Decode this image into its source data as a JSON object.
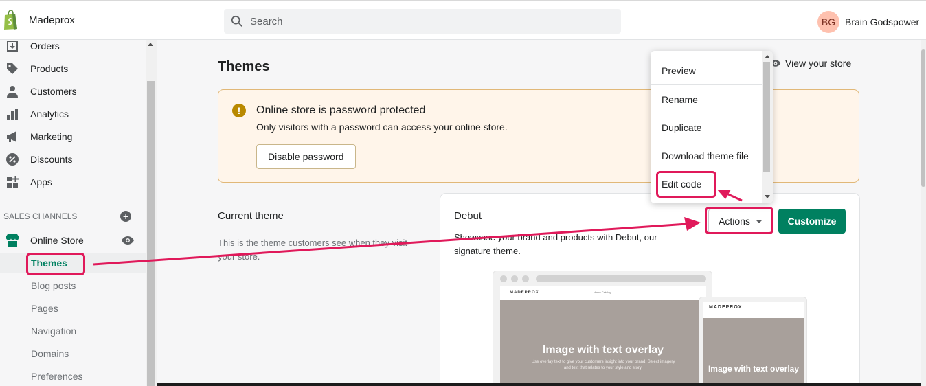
{
  "store": {
    "name": "Madeprox"
  },
  "search": {
    "placeholder": "Search"
  },
  "user": {
    "initials": "BG",
    "name": "Brain Godspower"
  },
  "sidebar": {
    "items": [
      {
        "label": "Orders",
        "icon": "orders-icon"
      },
      {
        "label": "Products",
        "icon": "tag-icon"
      },
      {
        "label": "Customers",
        "icon": "person-icon"
      },
      {
        "label": "Analytics",
        "icon": "bar-chart-icon"
      },
      {
        "label": "Marketing",
        "icon": "megaphone-icon"
      },
      {
        "label": "Discounts",
        "icon": "discount-icon"
      },
      {
        "label": "Apps",
        "icon": "apps-icon"
      }
    ],
    "sales_channels_label": "SALES CHANNELS",
    "online_store": "Online Store",
    "sub_items": [
      "Themes",
      "Blog posts",
      "Pages",
      "Navigation",
      "Domains",
      "Preferences"
    ],
    "active_sub_item": "Themes"
  },
  "main": {
    "page_title": "Themes",
    "view_store": "View your store",
    "banner": {
      "title": "Online store is password protected",
      "text": "Only visitors with a password can access your online store.",
      "button": "Disable password"
    },
    "current_theme": {
      "heading": "Current theme",
      "description": "This is the theme customers see when they visit your store."
    },
    "theme_card": {
      "name": "Debut",
      "description": "Showcase your brand and products with Debut, our signature theme.",
      "actions_button": "Actions",
      "customize_button": "Customize",
      "preview": {
        "store_name": "MADEPROX",
        "nav_links": "Home   Catalog",
        "desktop_hero_title": "Image with text overlay",
        "desktop_hero_sub": "Use overlay text to give your customers insight into your brand. Select imagery and text that relates to your style and story.",
        "mobile_hero_title": "Image with text overlay"
      }
    }
  },
  "actions_menu": {
    "items": [
      "Preview",
      "Rename",
      "Duplicate",
      "Download theme file",
      "Edit code"
    ],
    "highlighted": "Edit code"
  },
  "colors": {
    "accent": "#008060",
    "annotation": "#e0195a",
    "banner_bg": "#fff5ea"
  }
}
